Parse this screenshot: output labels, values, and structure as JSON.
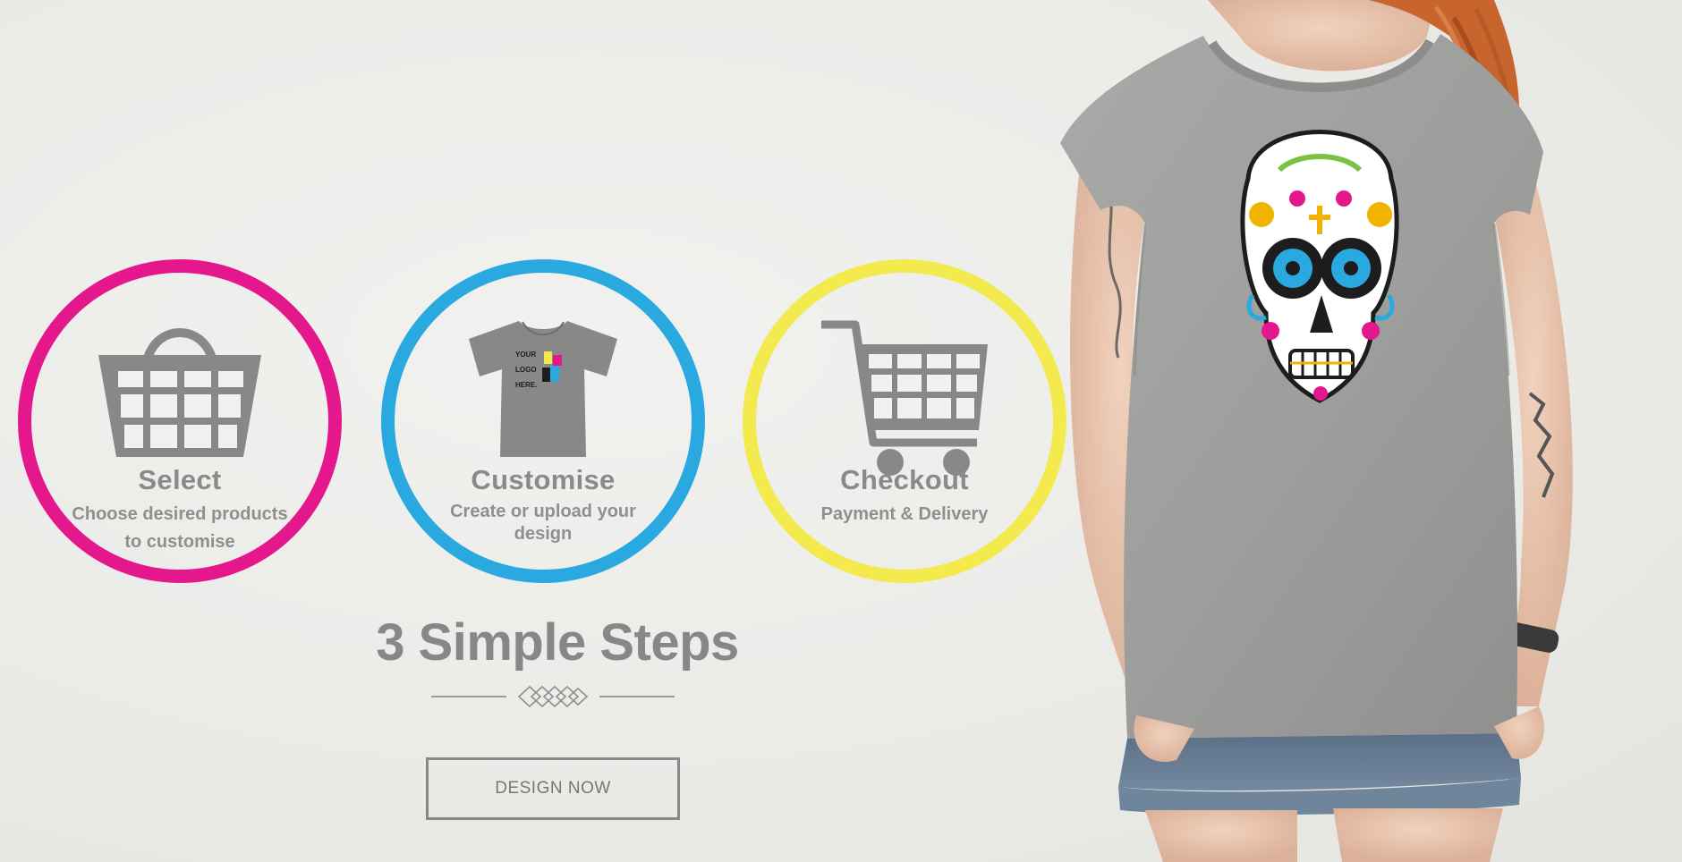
{
  "colors": {
    "magenta": "#e5178d",
    "cyan": "#2aa9e0",
    "yellow": "#f3ea4d",
    "icon_gray": "#888888",
    "text_gray": "#8a8a8a"
  },
  "steps": [
    {
      "icon": "shopping-basket-icon",
      "color": "#e5178d",
      "title": "Select",
      "text": "Choose desired products to customise"
    },
    {
      "icon": "t-shirt-logo-icon",
      "color": "#2aa9e0",
      "title": "Customise",
      "text": "Create or upload your design",
      "icon_text": [
        "YOUR",
        "LOGO",
        "HERE."
      ]
    },
    {
      "icon": "shopping-cart-icon",
      "color": "#f3ea4d",
      "title": "Checkout",
      "text": "Payment & Delivery"
    }
  ],
  "headline": "3 Simple Steps",
  "divider_icon": "diamond-ornament-icon",
  "cta": {
    "label": "DESIGN NOW"
  },
  "photo": {
    "subject": "model-sugar-skull-tshirt-image"
  }
}
